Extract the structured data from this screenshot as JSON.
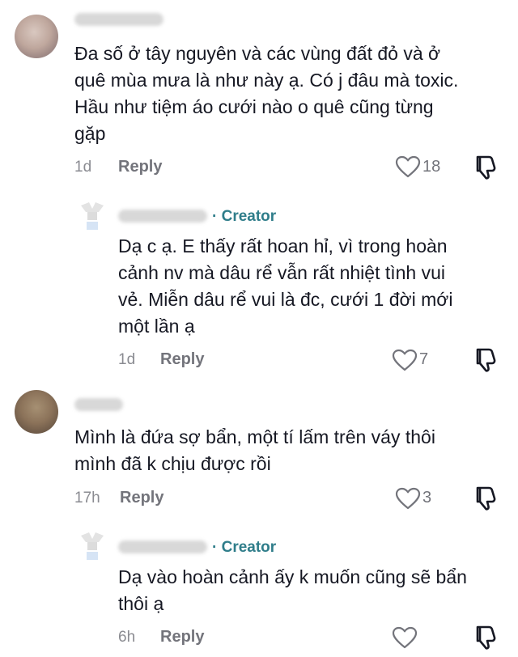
{
  "comments": [
    {
      "text": "Đa số ở tây nguyên và các vùng đất đỏ và ở\nquê mùa mưa là như này ạ. Có j đâu mà toxic.\nHầu như tiệm áo cưới nào o quê cũng từng\ngặp",
      "time": "1d",
      "reply_label": "Reply",
      "likes": "18",
      "reply": {
        "badge": "· Creator",
        "text": "Dạ c ạ. E thấy rất hoan hỉ, vì trong hoàn\ncảnh nv mà dâu rể vẫn rất nhiệt tình vui\nvẻ. Miễn dâu rể vui là đc, cưới 1 đời mới\nmột lần ạ",
        "time": "1d",
        "reply_label": "Reply",
        "likes": "7"
      }
    },
    {
      "text": "Mình là đứa sợ bẩn, một tí lấm trên váy thôi\nmình đã k chịu được rồi",
      "time": "17h",
      "reply_label": "Reply",
      "likes": "3",
      "reply": {
        "badge": "· Creator",
        "text": "Dạ vào hoàn cảnh ấy k muốn cũng sẽ bẩn\nthôi ạ",
        "time": "6h",
        "reply_label": "Reply",
        "likes": ""
      }
    }
  ]
}
